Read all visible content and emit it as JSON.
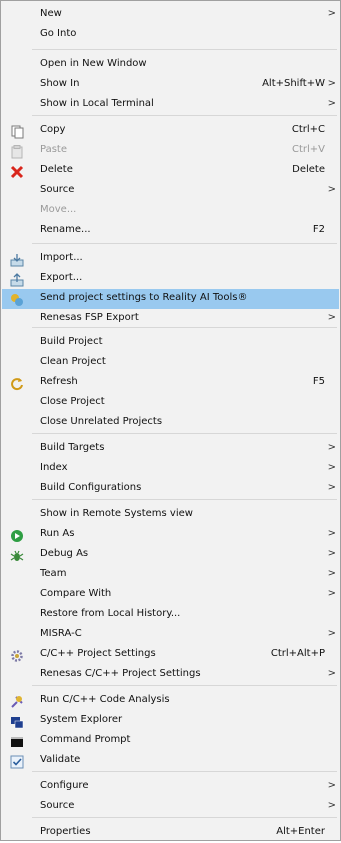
{
  "menu": {
    "items": [
      {
        "label": "New",
        "arrow": true
      },
      {
        "label": "Go Into"
      },
      {
        "label": "Open in New Window"
      },
      {
        "label": "Show In",
        "shortcut": "Alt+Shift+W",
        "arrow": true
      },
      {
        "label": "Show in Local Terminal",
        "arrow": true
      },
      {
        "label": "Copy",
        "shortcut": "Ctrl+C",
        "icon": "copy-icon"
      },
      {
        "label": "Paste",
        "shortcut": "Ctrl+V",
        "icon": "paste-icon",
        "disabled": true
      },
      {
        "label": "Delete",
        "shortcut": "Delete",
        "icon": "delete-icon"
      },
      {
        "label": "Source",
        "arrow": true
      },
      {
        "label": "Move...",
        "disabled": true
      },
      {
        "label": "Rename...",
        "shortcut": "F2"
      },
      {
        "label": "Import...",
        "icon": "import-icon"
      },
      {
        "label": "Export...",
        "icon": "export-icon"
      },
      {
        "label": "Send project settings to Reality AI Tools®",
        "icon": "reality-ai-icon",
        "highlighted": true
      },
      {
        "label": "Renesas FSP Export",
        "arrow": true
      },
      {
        "label": "Build Project"
      },
      {
        "label": "Clean Project"
      },
      {
        "label": "Refresh",
        "shortcut": "F5",
        "icon": "refresh-icon"
      },
      {
        "label": "Close Project"
      },
      {
        "label": "Close Unrelated Projects"
      },
      {
        "label": "Build Targets",
        "arrow": true
      },
      {
        "label": "Index",
        "arrow": true
      },
      {
        "label": "Build Configurations",
        "arrow": true
      },
      {
        "label": "Show in Remote Systems view"
      },
      {
        "label": "Run As",
        "arrow": true,
        "icon": "run-icon"
      },
      {
        "label": "Debug As",
        "arrow": true,
        "icon": "debug-icon"
      },
      {
        "label": "Team",
        "arrow": true
      },
      {
        "label": "Compare With",
        "arrow": true
      },
      {
        "label": "Restore from Local History..."
      },
      {
        "label": "MISRA-C",
        "arrow": true
      },
      {
        "label": "C/C++ Project Settings",
        "shortcut": "Ctrl+Alt+P",
        "icon": "settings-icon"
      },
      {
        "label": "Renesas C/C++ Project Settings",
        "arrow": true
      },
      {
        "label": "Run C/C++ Code Analysis",
        "icon": "code-analysis-icon"
      },
      {
        "label": "System Explorer",
        "icon": "system-explorer-icon"
      },
      {
        "label": "Command Prompt",
        "icon": "command-prompt-icon"
      },
      {
        "label": "Validate",
        "icon": "validate-checkbox-icon"
      },
      {
        "label": "Configure",
        "arrow": true
      },
      {
        "label": "Source",
        "arrow": true
      },
      {
        "label": "Properties",
        "shortcut": "Alt+Enter"
      }
    ],
    "submenu_arrow": ">",
    "colors": {
      "highlight": "#99c9ef",
      "delete": "#d9261c",
      "run": "#2e9e43"
    }
  }
}
